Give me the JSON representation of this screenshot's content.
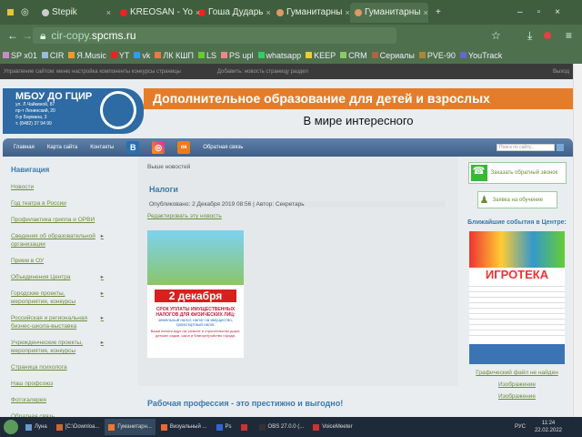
{
  "browser": {
    "tabs": [
      {
        "label": "Stepik",
        "active": false
      },
      {
        "label": "KREOSAN - Yo",
        "active": false
      },
      {
        "label": "Гоша Дударь",
        "active": false
      },
      {
        "label": "Гуманитарны",
        "active": false
      },
      {
        "label": "Гуманитарны",
        "active": true
      }
    ],
    "new_tab": "+",
    "url_prefix": "cir-copy.",
    "url_domain": "spcms.ru",
    "bookmarks": [
      "SP x01",
      "CIR",
      "Я.Music",
      "YT",
      "vk",
      "ЛК КШП",
      "LS",
      "PS upl",
      "whatsapp",
      "KEEP",
      "CRM",
      "Сериалы",
      "PVE-90",
      "YouTrack"
    ]
  },
  "admin": {
    "left": "Управление сайтом: меню  настройка  компоненты  конкурсы  страницы",
    "mid": "Добавить: новость  страницу  раздел",
    "logout": "Выход"
  },
  "header": {
    "org": "МБОУ ДО ГЦИР",
    "addr": [
      "ул. Л.Чайкиной, 87",
      "пр-т Ленинский, 20",
      "б-р Баумана, 3",
      "т. (8482) 37 94 99"
    ],
    "banner": "Дополнительное образование для детей и взрослых",
    "subtitle": "В мире интересного"
  },
  "nav": {
    "items": [
      "Главная",
      "Карта сайта",
      "Контакты"
    ],
    "feedback": "Обратная связь",
    "search_placeholder": "Поиск по сайту...",
    "vk": "В",
    "ok": "ок"
  },
  "sidebar": {
    "title": "Навигация",
    "items": [
      {
        "label": "Новости",
        "sub": false
      },
      {
        "label": "Год театра в России",
        "sub": false
      },
      {
        "label": "Профилактика гриппа и ОРВИ",
        "sub": false
      },
      {
        "label": "Сведения об образовательной организации",
        "sub": true
      },
      {
        "label": "Прием в ОУ",
        "sub": false
      },
      {
        "label": "Объединения Центра",
        "sub": true
      },
      {
        "label": "Городские проекты, мероприятия, конкурсы",
        "sub": true
      },
      {
        "label": "Российская и региональная бизнес-школа-выставка",
        "sub": true
      },
      {
        "label": "Учрежденческие проекты, мероприятия, конкурсы",
        "sub": true
      },
      {
        "label": "Страница психолога",
        "sub": false
      },
      {
        "label": "Наш профсоюз",
        "sub": false
      },
      {
        "label": "Фотогалерея",
        "sub": false
      },
      {
        "label": "Обратная связь",
        "sub": false
      }
    ]
  },
  "main": {
    "crumb": "Выше новостей",
    "title": "Налоги",
    "published": "Опубликовано: 2 Декабря 2019 08:56 | Автор: Секретарь",
    "edit": "Редактировать эту новость",
    "poster": {
      "date": "2 декабря",
      "line1": "СРОК УПЛАТЫ ИМУЩЕСТВЕННЫХ НАЛОГОВ ДЛЯ ФИЗИЧЕСКИХ ЛИЦ:",
      "line2": "земельный налог, налог на имущество, транспортный налог.",
      "line3": "Ваши налоги идут на: ремонт и строительство дорог, детских садов, школ и благоустройство города."
    },
    "next_title": "Рабочая профессия - это престижно и выгодно!"
  },
  "right": {
    "callback": "Заказать обратный звонок",
    "enroll": "Заявка на обучение",
    "events_title": "Ближайшие события в Центре:",
    "event_name": "ИГРОТЕКА",
    "missing": "Графический файл не найден",
    "img1": "Изображение",
    "img2": "Изображение"
  },
  "taskbar": {
    "items": [
      "Луна",
      "[C:\\Downloa...",
      "Гуманитарн...",
      "Визуальный ...",
      "Ps",
      "",
      "OBS 27.0.0 (...",
      "VoiceMeeter"
    ],
    "lang": "РУС",
    "time": "11:24",
    "date": "22.02.2022"
  }
}
